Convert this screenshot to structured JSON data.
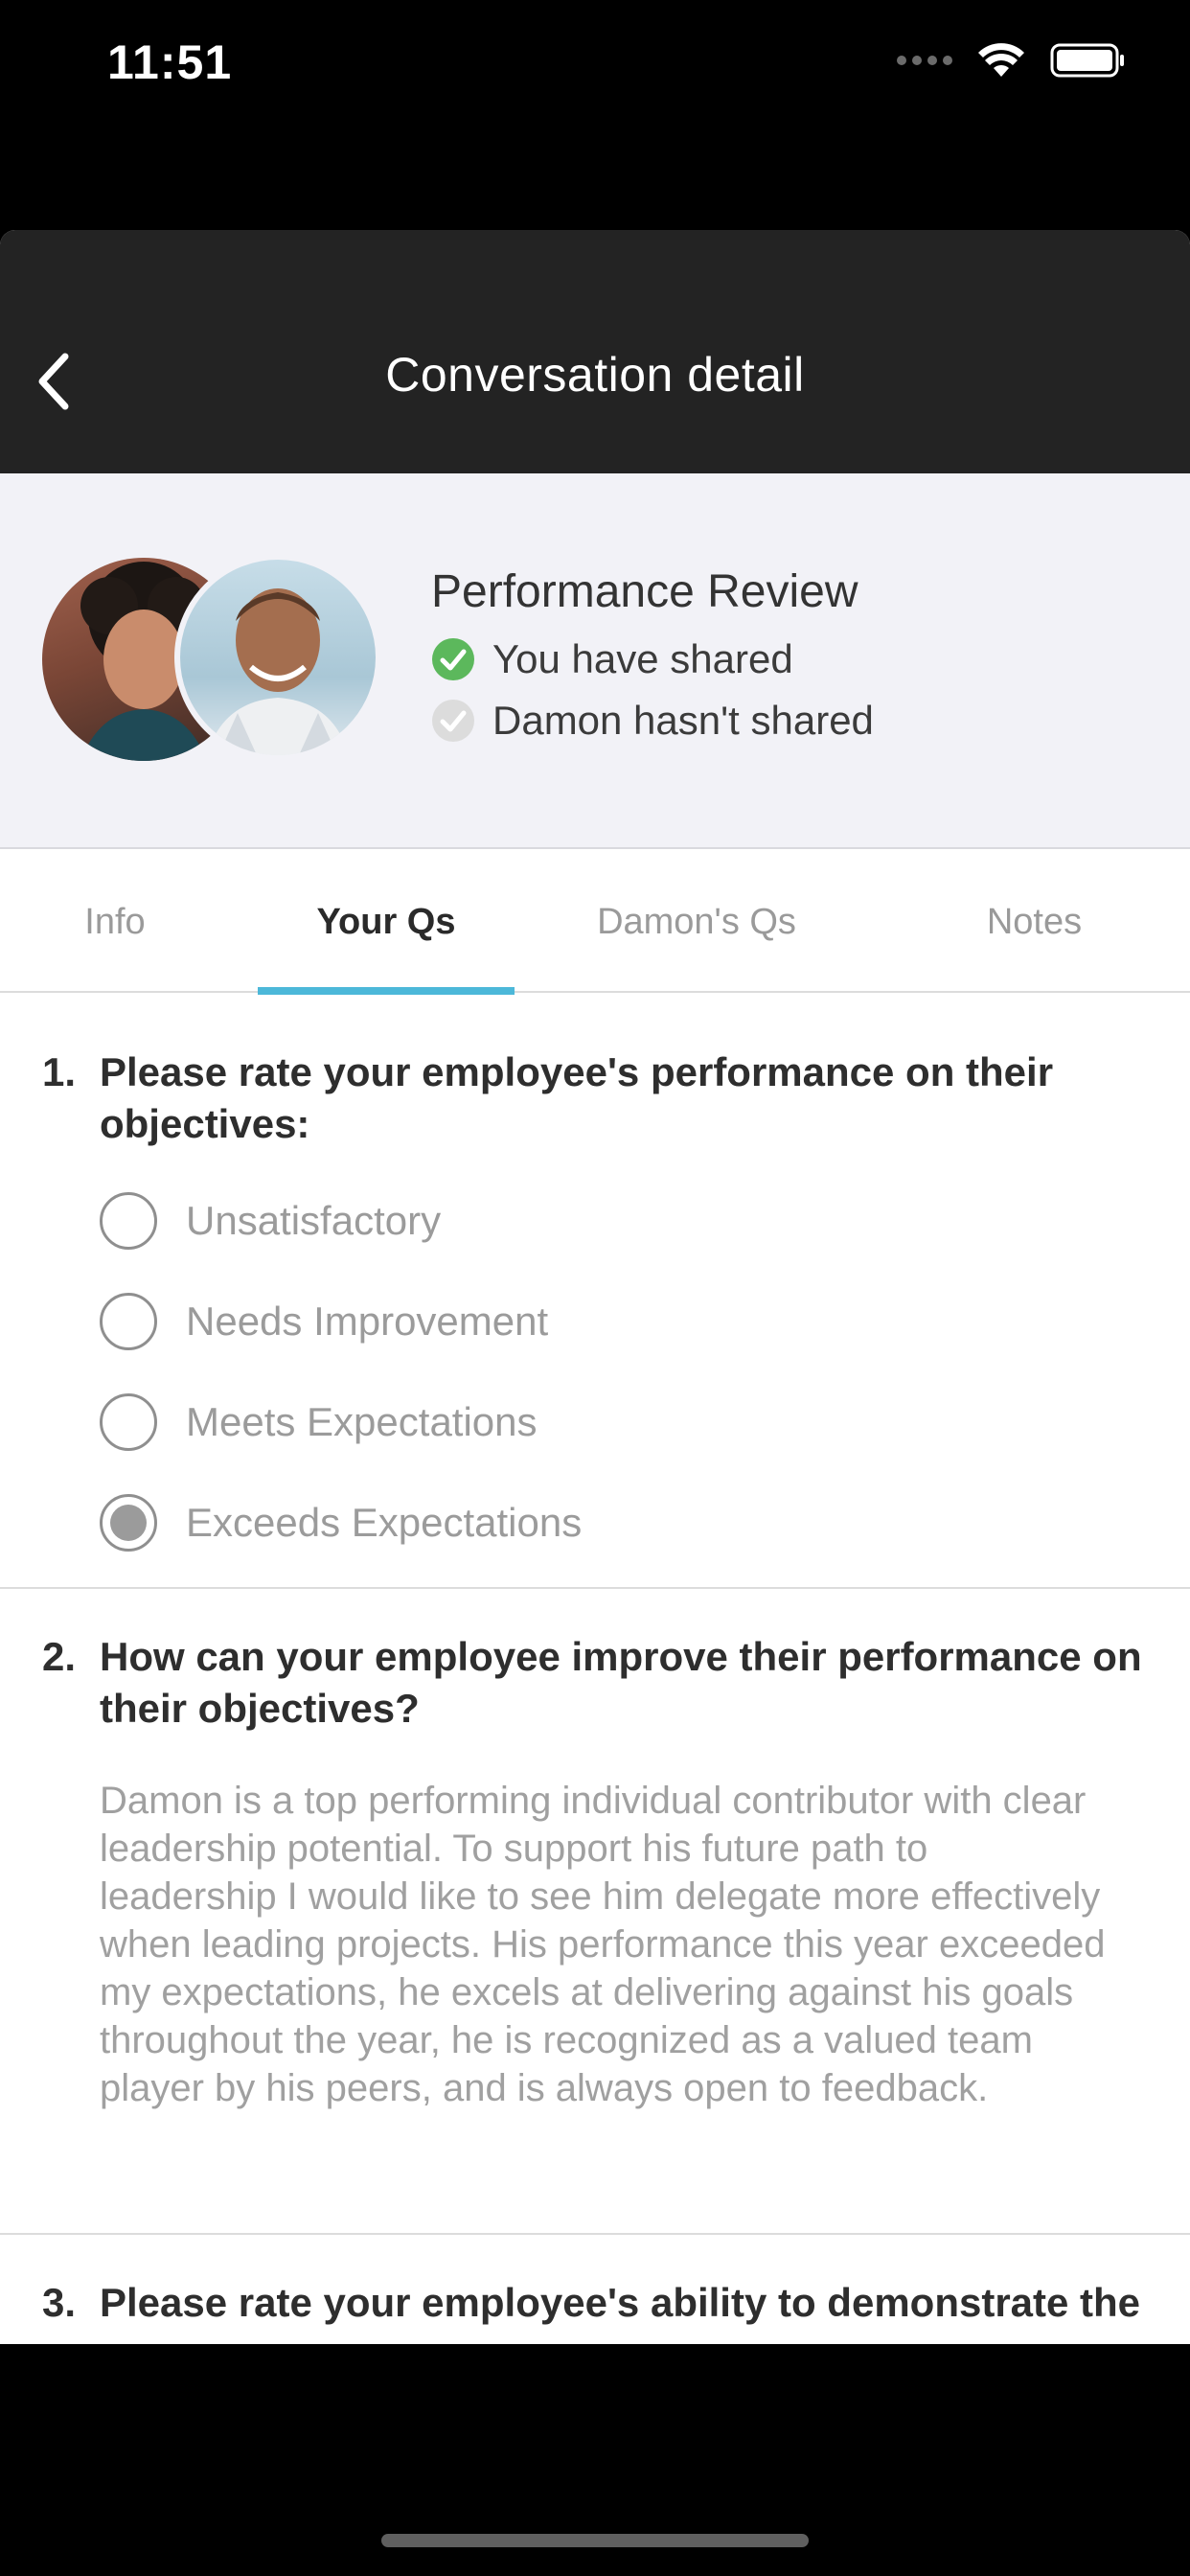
{
  "status_bar": {
    "time": "11:51"
  },
  "nav": {
    "title": "Conversation detail",
    "back_icon": "chevron-left-icon"
  },
  "header": {
    "title": "Performance Review",
    "shares": [
      {
        "text": "You have shared",
        "icon": "check-circle-icon",
        "color": "#5cb85c"
      },
      {
        "text": "Damon hasn't shared",
        "icon": "check-circle-icon",
        "color": "#d6d6d6"
      }
    ]
  },
  "tabs": [
    {
      "label": "Info",
      "active": false
    },
    {
      "label": "Your Qs",
      "active": true
    },
    {
      "label": "Damon's Qs",
      "active": false
    },
    {
      "label": "Notes",
      "active": false
    }
  ],
  "questions": [
    {
      "number": "1.",
      "text": "Please rate your employee's performance on their objectives:",
      "options": [
        "Unsatisfactory",
        "Needs Improvement",
        "Meets Expectations",
        "Exceeds Expectations"
      ],
      "selected": "Exceeds Expectations"
    },
    {
      "number": "2.",
      "text": "How can your employee improve their performance on their objectives?",
      "answer": "Damon is a top performing individual contributor with clear leadership potential.  To support his future path to leadership I would like to see him delegate more effectively when leading projects. His performance this year exceeded my expectations, he excels at delivering against his goals throughout the year,  he is recognized as a valued team player by his peers, and is always open to feedback."
    },
    {
      "number": "3.",
      "text": "Please rate your employee's ability to demonstrate the"
    }
  ],
  "colors": {
    "accent": "#4cb8d9",
    "nav_background": "#232323",
    "header_background": "#f2f2f7"
  }
}
